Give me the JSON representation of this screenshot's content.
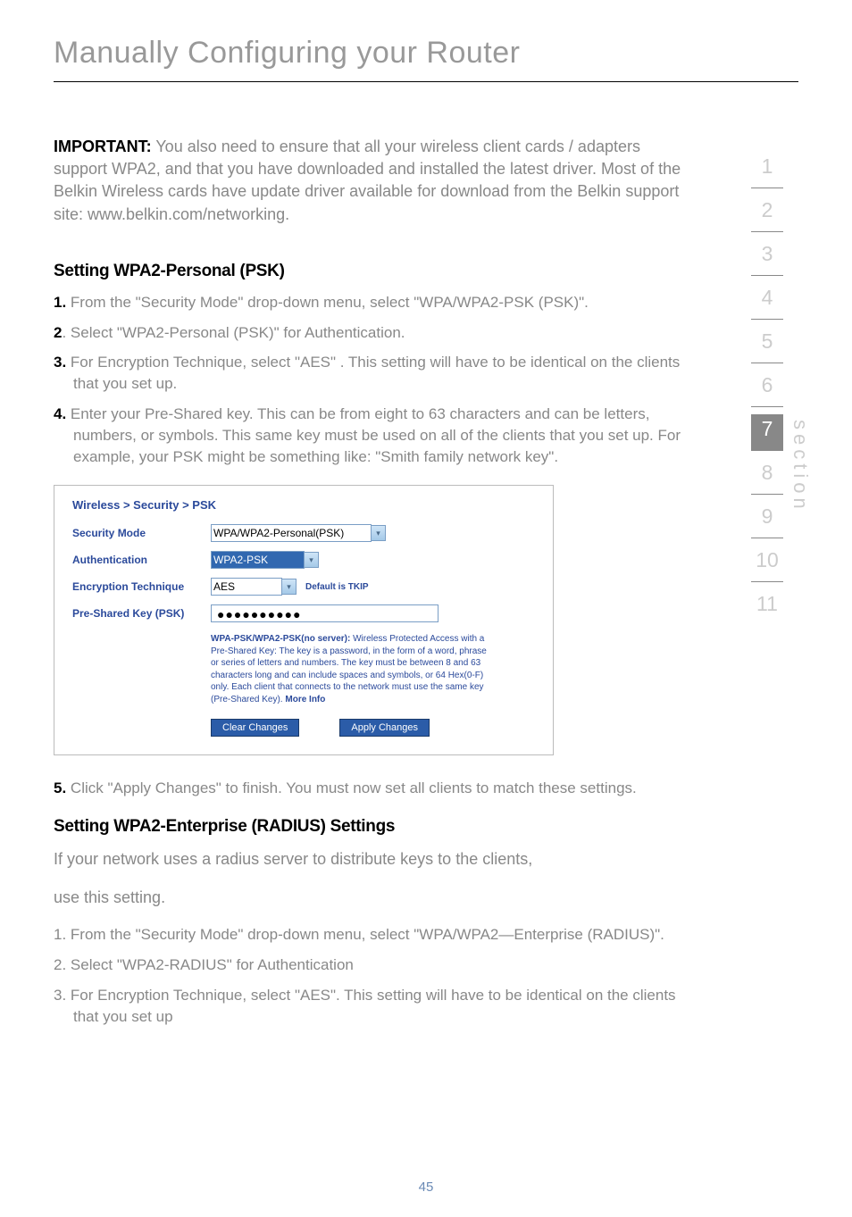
{
  "title": "Manually Configuring your Router",
  "important": {
    "label": "IMPORTANT:",
    "text": " You also need to ensure that all your wireless client cards / adapters support WPA2, and that you have downloaded and installed the latest driver. Most of the Belkin Wireless cards have update driver available for download from the Belkin support site: www.belkin.com/networking."
  },
  "section1": {
    "heading": "Setting WPA2-Personal (PSK)",
    "steps": [
      {
        "num": "1.",
        "text": " From the \"Security Mode\" drop-down menu, select \"WPA/WPA2-PSK (PSK)\"."
      },
      {
        "num": "2",
        "text": ". Select \"WPA2-Personal (PSK)\" for Authentication."
      },
      {
        "num": "3.",
        "text": " For Encryption Technique, select \"AES\" . This setting will have to be identical on the clients that you set up."
      },
      {
        "num": "4.",
        "text": " Enter your Pre-Shared key. This can be from eight to 63 characters and can be letters, numbers, or symbols. This same key must be used on all of the clients that you set up. For example, your PSK might be something like: \"Smith family network key\"."
      }
    ]
  },
  "screenshot": {
    "breadcrumb": "Wireless > Security > PSK",
    "rows": {
      "security_mode": {
        "label": "Security Mode",
        "value": "WPA/WPA2-Personal(PSK)"
      },
      "authentication": {
        "label": "Authentication",
        "value": "WPA2-PSK"
      },
      "encryption": {
        "label": "Encryption Technique",
        "value": "AES",
        "note": "Default is TKIP"
      },
      "psk": {
        "label": "Pre-Shared Key (PSK)",
        "value": "●●●●●●●●●●"
      }
    },
    "help": {
      "bold": "WPA-PSK/WPA2-PSK(no server): ",
      "body": "Wireless Protected Access with a Pre-Shared Key: The key is a password, in the form of a word, phrase or series of letters and numbers. The key must be between 8 and 63 characters long and can include spaces and symbols, or 64 Hex(0-F) only. Each client that connects to the network must use the same key (Pre-Shared Key). ",
      "link": "More Info"
    },
    "buttons": {
      "clear": "Clear Changes",
      "apply": "Apply Changes"
    }
  },
  "step5": {
    "num": "5.",
    "text": " Click \"Apply Changes\" to finish. You must now set all clients to match these settings."
  },
  "section2": {
    "heading": "Setting WPA2-Enterprise (RADIUS) Settings",
    "intro1": "If your network uses a radius server to distribute keys to the clients,",
    "intro2": "use this setting.",
    "steps": [
      {
        "num": "1.",
        "text": " From the \"Security Mode\" drop-down menu, select \"WPA/WPA2—Enterprise (RADIUS)\"."
      },
      {
        "num": "2.",
        "text": " Select \"WPA2-RADIUS\" for Authentication"
      },
      {
        "num": "3.",
        "text": " For Encryption Technique, select \"AES\". This setting will have to be identical on the clients that you set up"
      }
    ]
  },
  "sidebar": {
    "label": "section",
    "numbers": [
      "1",
      "2",
      "3",
      "4",
      "5",
      "6",
      "7",
      "8",
      "9",
      "10",
      "11"
    ],
    "active": 6
  },
  "page_number": "45"
}
